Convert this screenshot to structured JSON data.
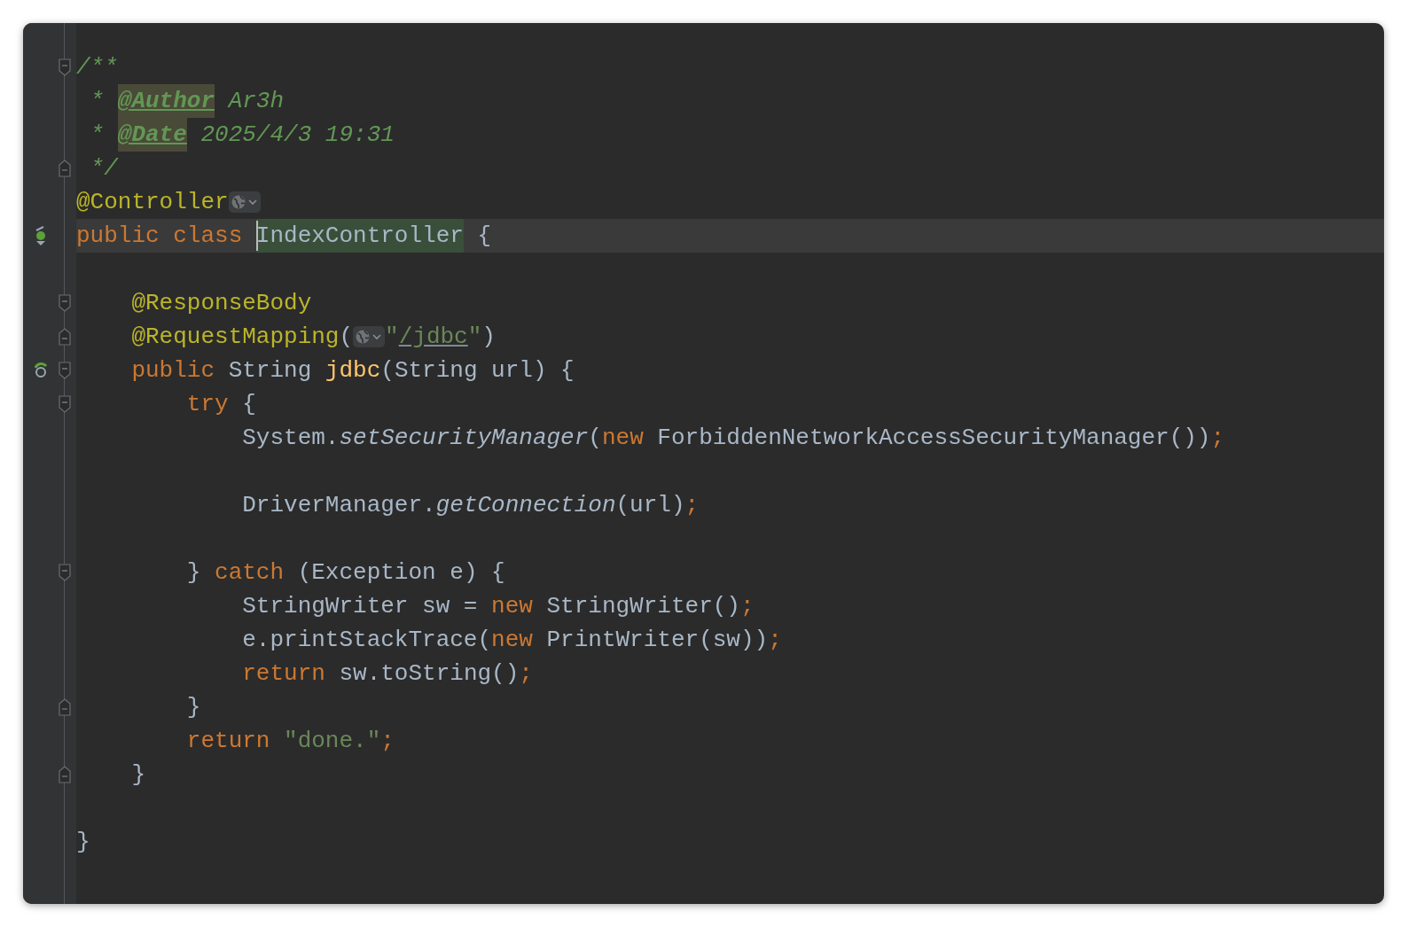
{
  "lines": [
    {
      "fold_start": true,
      "tokens": [
        {
          "t": "/**",
          "kind": "comment"
        }
      ]
    },
    {
      "tokens": [
        {
          "t": " * ",
          "kind": "comment"
        },
        {
          "t": "@Author",
          "kind": "doctag"
        },
        {
          "t": " Ar3h",
          "kind": "comment"
        }
      ]
    },
    {
      "tokens": [
        {
          "t": " * ",
          "kind": "comment"
        },
        {
          "t": "@Date",
          "kind": "doctag"
        },
        {
          "t": " 2025/4/3 19:31",
          "kind": "comment"
        }
      ]
    },
    {
      "fold_end": true,
      "tokens": [
        {
          "t": " */",
          "kind": "comment"
        }
      ]
    },
    {
      "tokens": [
        {
          "t": "@Controller",
          "kind": "ann"
        },
        {
          "kind": "inlay"
        }
      ]
    },
    {
      "current": true,
      "class_marker": true,
      "tokens": [
        {
          "t": "public class ",
          "kind": "kw"
        },
        {
          "t": "IndexController",
          "kind": "plain",
          "highlighted": true,
          "caret": true
        },
        {
          "t": " {",
          "kind": "plain"
        }
      ]
    },
    {
      "fold_start": true,
      "gap_before": true,
      "tokens": [
        {
          "t": "    @ResponseBody",
          "kind": "ann"
        }
      ]
    },
    {
      "fold_end": true,
      "tokens": [
        {
          "t": "    @RequestMapping",
          "kind": "ann"
        },
        {
          "t": "(",
          "kind": "plain"
        },
        {
          "kind": "inlay"
        },
        {
          "t": "\"",
          "kind": "str"
        },
        {
          "t": "/jdbc",
          "kind": "link"
        },
        {
          "t": "\"",
          "kind": "str"
        },
        {
          "t": ")",
          "kind": "plain"
        }
      ]
    },
    {
      "fold_start": true,
      "method_marker": true,
      "tokens": [
        {
          "t": "    public ",
          "kind": "kw"
        },
        {
          "t": "String ",
          "kind": "plain"
        },
        {
          "t": "jdbc",
          "kind": "fn"
        },
        {
          "t": "(String url) {",
          "kind": "plain"
        }
      ]
    },
    {
      "fold_start": true,
      "tokens": [
        {
          "t": "        try ",
          "kind": "kw"
        },
        {
          "t": "{",
          "kind": "plain"
        }
      ]
    },
    {
      "tokens": [
        {
          "t": "            System.",
          "kind": "plain"
        },
        {
          "t": "setSecurityManager",
          "kind": "call"
        },
        {
          "t": "(",
          "kind": "plain"
        },
        {
          "t": "new ",
          "kind": "kw"
        },
        {
          "t": "ForbiddenNetworkAccessSecurityManager())",
          "kind": "plain"
        },
        {
          "t": ";",
          "kind": "kw"
        }
      ]
    },
    {
      "gap_before": true,
      "tokens": [
        {
          "t": "            DriverManager.",
          "kind": "plain"
        },
        {
          "t": "getConnection",
          "kind": "call"
        },
        {
          "t": "(url)",
          "kind": "plain"
        },
        {
          "t": ";",
          "kind": "kw"
        }
      ]
    },
    {
      "fold_start": true,
      "gap_before": true,
      "tokens": [
        {
          "t": "        } ",
          "kind": "plain"
        },
        {
          "t": "catch ",
          "kind": "kw"
        },
        {
          "t": "(Exception e) {",
          "kind": "plain"
        }
      ]
    },
    {
      "tokens": [
        {
          "t": "            StringWriter sw = ",
          "kind": "plain"
        },
        {
          "t": "new ",
          "kind": "kw"
        },
        {
          "t": "StringWriter()",
          "kind": "plain"
        },
        {
          "t": ";",
          "kind": "kw"
        }
      ]
    },
    {
      "tokens": [
        {
          "t": "            e.printStackTrace(",
          "kind": "plain"
        },
        {
          "t": "new ",
          "kind": "kw"
        },
        {
          "t": "PrintWriter(sw))",
          "kind": "plain"
        },
        {
          "t": ";",
          "kind": "kw"
        }
      ]
    },
    {
      "tokens": [
        {
          "t": "            return ",
          "kind": "kw"
        },
        {
          "t": "sw.toString()",
          "kind": "plain"
        },
        {
          "t": ";",
          "kind": "kw"
        }
      ]
    },
    {
      "fold_end": true,
      "tokens": [
        {
          "t": "        }",
          "kind": "plain"
        }
      ]
    },
    {
      "tokens": [
        {
          "t": "        return ",
          "kind": "kw"
        },
        {
          "t": "\"done.\"",
          "kind": "str"
        },
        {
          "t": ";",
          "kind": "kw"
        }
      ]
    },
    {
      "fold_end": true,
      "tokens": [
        {
          "t": "    }",
          "kind": "plain"
        }
      ]
    },
    {
      "gap_before": true,
      "tokens": [
        {
          "t": "}",
          "kind": "plain"
        }
      ]
    }
  ]
}
